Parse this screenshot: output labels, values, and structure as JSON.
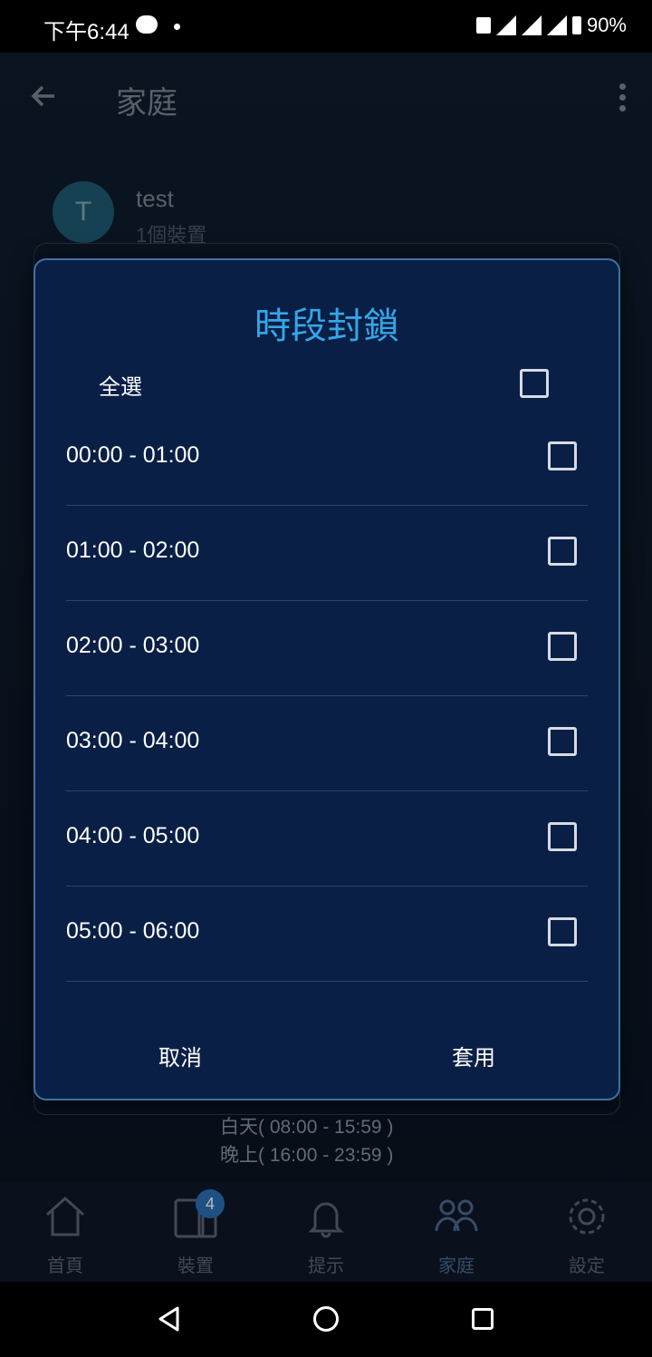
{
  "statusbar": {
    "time": "下午6:44",
    "battery": "90%"
  },
  "appbar": {
    "title": "家庭"
  },
  "member": {
    "initial": "T",
    "name": "test",
    "devices": "1個裝置"
  },
  "legend": [
    "白天( 08:00 - 15:59 )",
    "晚上( 16:00 - 23:59 )"
  ],
  "dialog": {
    "title": "時段封鎖",
    "select_all": "全選",
    "slots": [
      "00:00 - 01:00",
      "01:00 - 02:00",
      "02:00 - 03:00",
      "03:00 - 04:00",
      "04:00 - 05:00",
      "05:00 - 06:00"
    ],
    "cancel": "取消",
    "apply": "套用"
  },
  "bottomnav": {
    "items": [
      "首頁",
      "裝置",
      "提示",
      "家庭",
      "設定"
    ],
    "active": "家庭",
    "devices_badge": "4"
  },
  "colors": {
    "accent": "#35a6e8",
    "dialog_bg": "#0a1f45",
    "border": "#3a73a8"
  }
}
